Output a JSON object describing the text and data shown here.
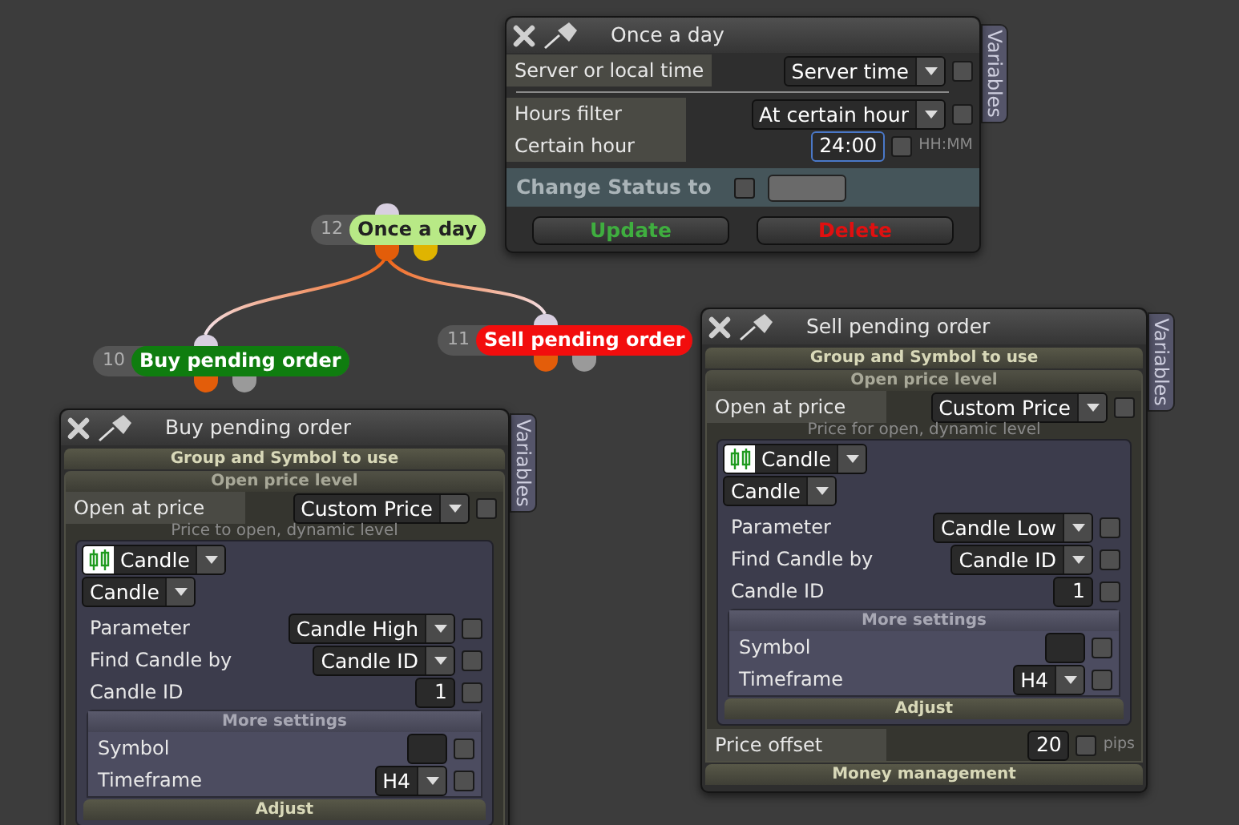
{
  "nodes": [
    {
      "number": "12",
      "label": "Once a day",
      "color": "#b8e986",
      "ports": [
        {
          "color": "#e35d0a"
        },
        {
          "color": "#e0b400"
        }
      ]
    },
    {
      "number": "10",
      "label": "Buy pending order",
      "color": "#0f7d0f",
      "ports": [
        {
          "color": "#e35d0a"
        },
        {
          "color": "#9a9a9a"
        }
      ]
    },
    {
      "number": "11",
      "label": "Sell pending order",
      "color": "#f20d0d",
      "ports": [
        {
          "color": "#e35d0a"
        },
        {
          "color": "#9a9a9a"
        }
      ]
    }
  ],
  "windows": [
    {
      "title": "Once a day",
      "side_tab": "Variables",
      "items": [
        {
          "kind": "select",
          "label": "Server or local time",
          "value": "Server time",
          "checked": false
        },
        {
          "kind": "divider"
        },
        {
          "kind": "select",
          "label": "Hours filter",
          "value": "At certain hour",
          "checked": false
        },
        {
          "kind": "input",
          "label": "Certain hour",
          "value": "24:00",
          "focused": true,
          "checked": false,
          "unit": "HH:MM"
        },
        {
          "kind": "status",
          "label": "Change Status to",
          "checked": false
        },
        {
          "kind": "buttons",
          "buttons": [
            {
              "label": "Update",
              "color": "#3fae3f"
            },
            {
              "label": "Delete",
              "color": "#e01010"
            }
          ]
        }
      ]
    },
    {
      "title": "Buy pending order",
      "side_tab": "Variables",
      "items": [
        {
          "kind": "header",
          "title": "Group and Symbol to use"
        },
        {
          "kind": "section",
          "title": "Open price level",
          "children": [
            {
              "kind": "select",
              "label": "Open at price",
              "value": "Custom Price",
              "checked": false
            },
            {
              "kind": "hint",
              "text": "Price to open, dynamic level"
            },
            {
              "kind": "panel",
              "children": [
                {
                  "kind": "candle",
                  "value": "Candle"
                },
                {
                  "kind": "dropdown",
                  "value": "Candle"
                },
                {
                  "kind": "select",
                  "label": "Parameter",
                  "value": "Candle High",
                  "checked": false
                },
                {
                  "kind": "select",
                  "label": "Find Candle by",
                  "value": "Candle ID",
                  "checked": false
                },
                {
                  "kind": "input",
                  "label": "Candle ID",
                  "value": "1",
                  "focused": false,
                  "checked": false
                },
                {
                  "kind": "subsection",
                  "title": "More settings",
                  "children": [
                    {
                      "kind": "input",
                      "label": "Symbol",
                      "focused": false,
                      "checked": false
                    },
                    {
                      "kind": "select",
                      "label": "Timeframe",
                      "value": "H4",
                      "checked": false
                    }
                  ]
                },
                {
                  "kind": "header",
                  "title": "Adjust"
                }
              ]
            }
          ]
        }
      ]
    },
    {
      "title": "Sell pending order",
      "side_tab": "Variables",
      "items": [
        {
          "kind": "header",
          "title": "Group and Symbol to use"
        },
        {
          "kind": "section",
          "title": "Open price level",
          "children": [
            {
              "kind": "select",
              "label": "Open at price",
              "value": "Custom Price",
              "checked": false
            },
            {
              "kind": "hint",
              "text": "Price for open, dynamic level"
            },
            {
              "kind": "panel",
              "children": [
                {
                  "kind": "candle",
                  "value": "Candle"
                },
                {
                  "kind": "dropdown",
                  "value": "Candle"
                },
                {
                  "kind": "select",
                  "label": "Parameter",
                  "value": "Candle Low",
                  "checked": false
                },
                {
                  "kind": "select",
                  "label": "Find Candle by",
                  "value": "Candle ID",
                  "checked": false
                },
                {
                  "kind": "input",
                  "label": "Candle ID",
                  "value": "1",
                  "focused": false,
                  "checked": false
                },
                {
                  "kind": "subsection",
                  "title": "More settings",
                  "children": [
                    {
                      "kind": "input",
                      "label": "Symbol",
                      "focused": false,
                      "checked": false
                    },
                    {
                      "kind": "select",
                      "label": "Timeframe",
                      "value": "H4",
                      "checked": false
                    }
                  ]
                },
                {
                  "kind": "header",
                  "title": "Adjust"
                }
              ]
            },
            {
              "kind": "input",
              "label": "Price offset",
              "value": "20",
              "focused": false,
              "checked": false,
              "unit": "pips"
            }
          ]
        },
        {
          "kind": "header",
          "title": "Money management"
        }
      ]
    }
  ]
}
